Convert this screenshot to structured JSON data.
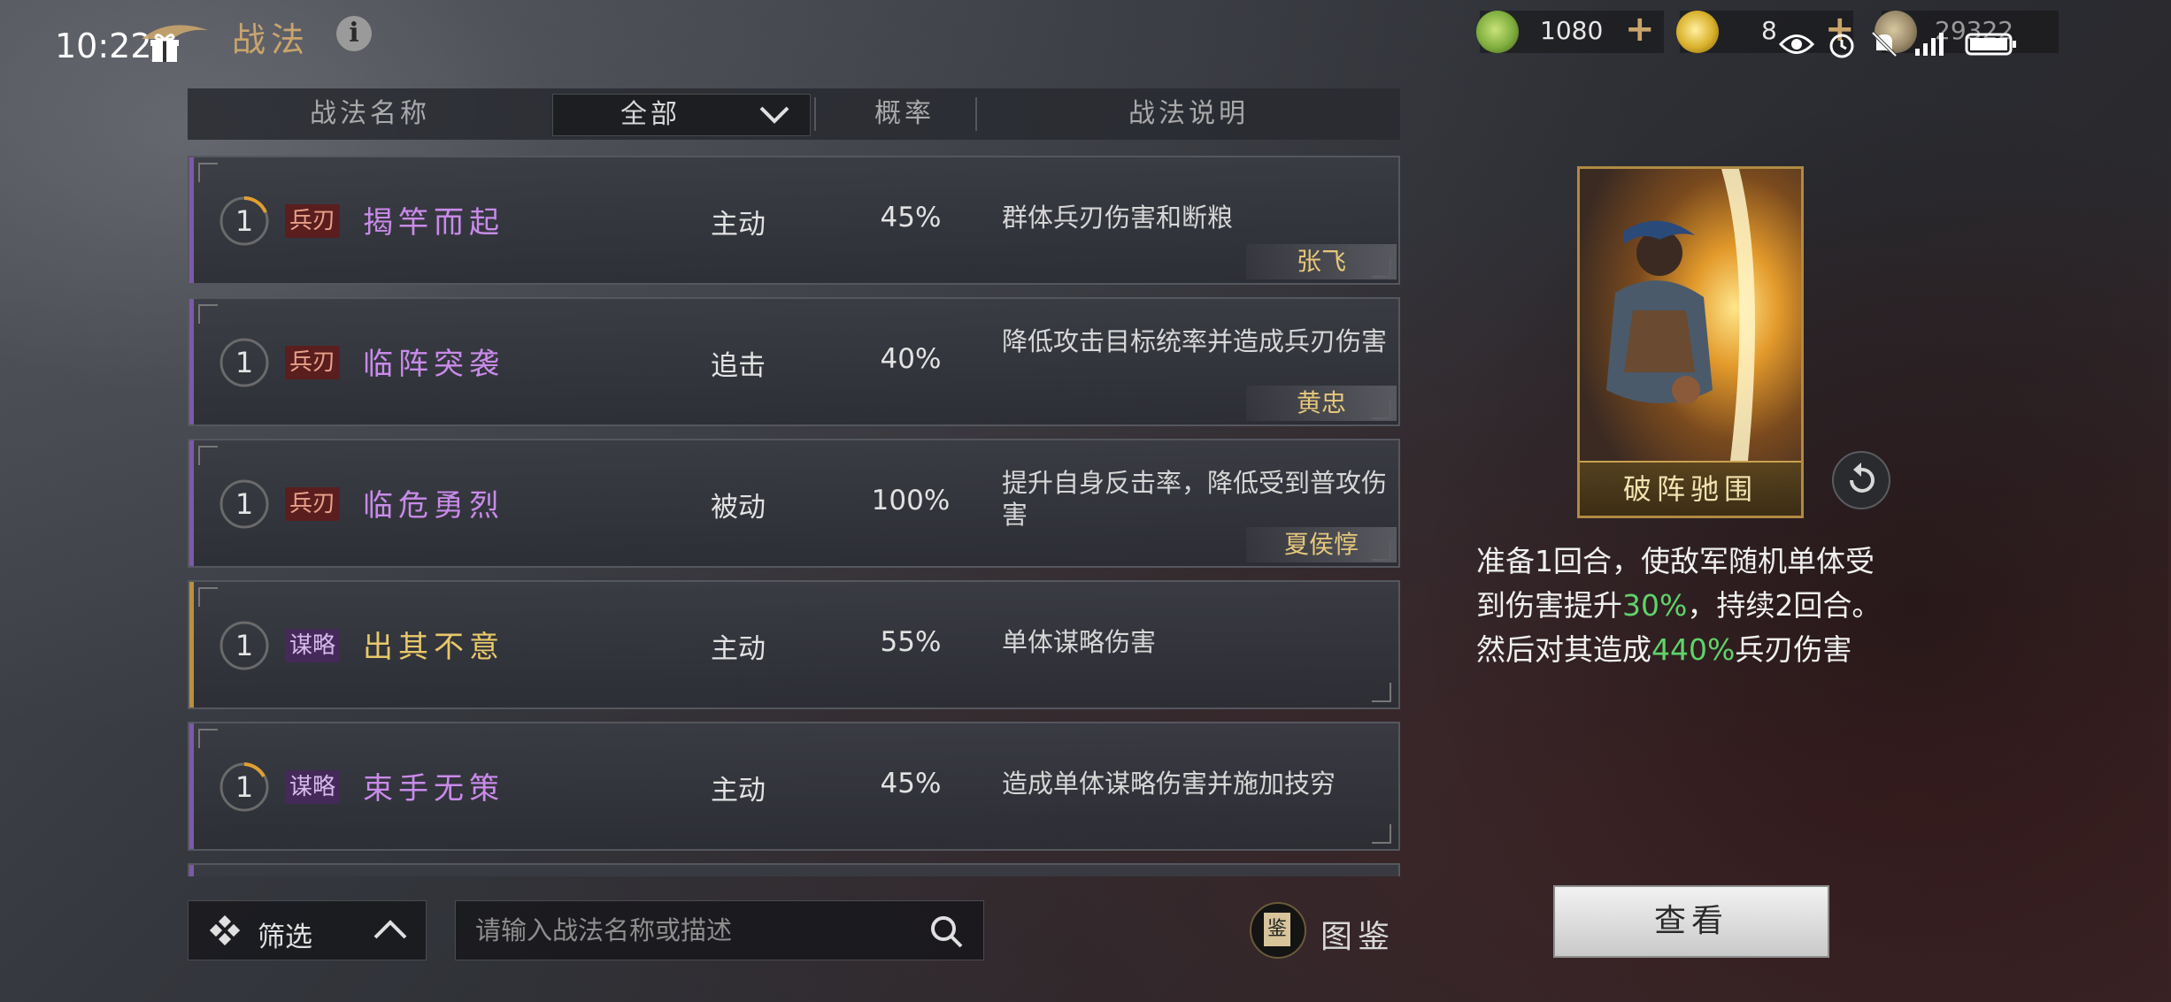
{
  "status": {
    "time": "10:22"
  },
  "header": {
    "title": "战法"
  },
  "resources": [
    {
      "name": "jade",
      "value": "1080",
      "color": "#7fae3e"
    },
    {
      "name": "gold",
      "value": "8",
      "color": "#d9b02a"
    },
    {
      "name": "copper",
      "value": "29322",
      "color": "#9a8a6a"
    }
  ],
  "table": {
    "col_name": "战法名称",
    "filter_selected": "全部",
    "col_prob": "概率",
    "col_desc": "战法说明"
  },
  "skills": [
    {
      "level": "1",
      "tag": "兵刃",
      "tag_kind": "blade",
      "name": "揭竿而起",
      "name_color": "#c98bea",
      "type": "主动",
      "prob": "45%",
      "desc": "群体兵刃伤害和断粮",
      "owner": "张飞",
      "accent": "#7b5aa8"
    },
    {
      "level": "1",
      "tag": "兵刃",
      "tag_kind": "blade",
      "name": "临阵突袭",
      "name_color": "#c98bea",
      "type": "追击",
      "prob": "40%",
      "desc": "降低攻击目标统率并造成兵刃伤害",
      "owner": "黄忠",
      "accent": "#7b5aa8"
    },
    {
      "level": "1",
      "tag": "兵刃",
      "tag_kind": "blade",
      "name": "临危勇烈",
      "name_color": "#c98bea",
      "type": "被动",
      "prob": "100%",
      "desc": "提升自身反击率，降低受到普攻伤害",
      "owner": "夏侯惇",
      "accent": "#7b5aa8"
    },
    {
      "level": "1",
      "tag": "谋略",
      "tag_kind": "mind",
      "name": "出其不意",
      "name_color": "#e8c86a",
      "type": "主动",
      "prob": "55%",
      "desc": "单体谋略伤害",
      "owner": "",
      "accent": "#b89040"
    },
    {
      "level": "1",
      "tag": "谋略",
      "tag_kind": "mind",
      "name": "束手无策",
      "name_color": "#c98bea",
      "type": "主动",
      "prob": "45%",
      "desc": "造成单体谋略伤害并施加技穷",
      "owner": "",
      "accent": "#7b5aa8"
    }
  ],
  "bottom": {
    "filter_label": "筛选",
    "search_placeholder": "请输入战法名称或描述",
    "codex_badge": "鉴",
    "codex_label": "图鉴"
  },
  "detail": {
    "card_name": "破阵驰围",
    "line1": "准备1回合，使敌军随机单体受",
    "line2_a": "到伤害提升",
    "line2_hl": "30%",
    "line2_b": "，持续2回合。",
    "line3_a": "然后对其造成",
    "line3_hl": "440%",
    "line3_b": "兵刃伤害",
    "view_button": "查看"
  }
}
